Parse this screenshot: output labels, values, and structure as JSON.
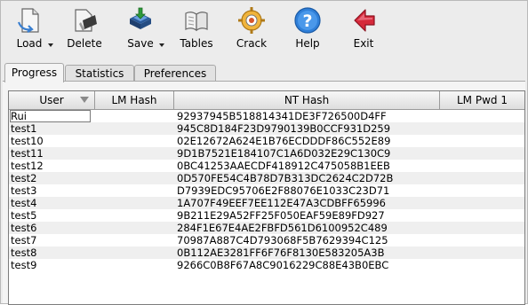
{
  "toolbar": {
    "buttons": [
      {
        "label": "Load",
        "icon": "load-icon",
        "dropdown": true
      },
      {
        "label": "Delete",
        "icon": "delete-icon",
        "dropdown": false
      },
      {
        "label": "Save",
        "icon": "save-icon",
        "dropdown": true
      },
      {
        "label": "Tables",
        "icon": "tables-icon",
        "dropdown": false
      },
      {
        "label": "Crack",
        "icon": "crack-icon",
        "dropdown": false
      },
      {
        "label": "Help",
        "icon": "help-icon",
        "dropdown": false
      },
      {
        "label": "Exit",
        "icon": "exit-icon",
        "dropdown": false
      }
    ]
  },
  "tabs": [
    {
      "label": "Progress",
      "active": true
    },
    {
      "label": "Statistics",
      "active": false
    },
    {
      "label": "Preferences",
      "active": false
    }
  ],
  "table": {
    "columns": [
      "User",
      "LM Hash",
      "NT Hash",
      "LM Pwd 1"
    ],
    "rows": [
      {
        "user": "Rui",
        "lm_hash": "",
        "nt_hash": "92937945B518814341DE3F726500D4FF",
        "lm_pwd1": ""
      },
      {
        "user": "test1",
        "lm_hash": "",
        "nt_hash": "945C8D184F23D9790139B0CCF931D259",
        "lm_pwd1": ""
      },
      {
        "user": "test10",
        "lm_hash": "",
        "nt_hash": "02E12672A624E1B76ECDDDF86C552E89",
        "lm_pwd1": ""
      },
      {
        "user": "test11",
        "lm_hash": "",
        "nt_hash": "9D1B7521E184107C1A6D032E29C130C9",
        "lm_pwd1": ""
      },
      {
        "user": "test12",
        "lm_hash": "",
        "nt_hash": "0BC41253AAECDF418912C475058B1EEB",
        "lm_pwd1": ""
      },
      {
        "user": "test2",
        "lm_hash": "",
        "nt_hash": "0D570FE54C4B78D7B313DC2624C2D72B",
        "lm_pwd1": ""
      },
      {
        "user": "test3",
        "lm_hash": "",
        "nt_hash": "D7939EDC95706E2F88076E1033C23D71",
        "lm_pwd1": ""
      },
      {
        "user": "test4",
        "lm_hash": "",
        "nt_hash": "1A707F49EEF7EE112E47A3CDBFF65996",
        "lm_pwd1": ""
      },
      {
        "user": "test5",
        "lm_hash": "",
        "nt_hash": "9B211E29A52FF25F050EAF59E89FD927",
        "lm_pwd1": ""
      },
      {
        "user": "test6",
        "lm_hash": "",
        "nt_hash": "284F1E67E4AE2FBFD561D6100952C489",
        "lm_pwd1": ""
      },
      {
        "user": "test7",
        "lm_hash": "",
        "nt_hash": "70987A887C4D793068F5B7629394C125",
        "lm_pwd1": ""
      },
      {
        "user": "test8",
        "lm_hash": "",
        "nt_hash": "0B112AE3281FF6F76F8130E583205A3B",
        "lm_pwd1": ""
      },
      {
        "user": "test9",
        "lm_hash": "",
        "nt_hash": "9266C0B8F67A8C9016229C88E43B0EBC",
        "lm_pwd1": ""
      }
    ]
  },
  "colors": {
    "window_bg": "#ececec",
    "table_bg": "#ffffff",
    "row_alt": "#efefef",
    "help_blue": "#2f7fd8",
    "exit_red": "#d6293a"
  }
}
